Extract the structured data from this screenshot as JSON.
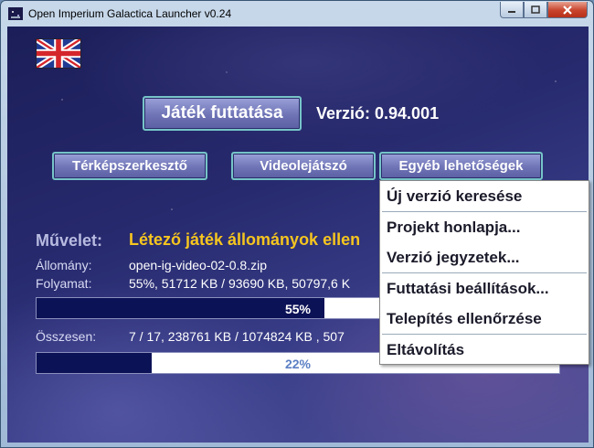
{
  "window": {
    "title": "Open Imperium Galactica Launcher v0.24"
  },
  "language": {
    "flag": "uk-flag-icon"
  },
  "main": {
    "run_label": "Játék futtatása",
    "version_text": "Verzió: 0.94.001",
    "map_editor_label": "Térképszerkesztő",
    "video_player_label": "Videolejátszó",
    "more_options_label": "Egyéb lehetőségek"
  },
  "status": {
    "operation_label": "Művelet:",
    "operation_value": "Létező játék állományok ellen",
    "file_label": "Állomány:",
    "file_value": "open-ig-video-02-0.8.zip",
    "progress_label": "Folyamat:",
    "progress_value": "55%, 51712 KB / 93690 KB, 50797,6 K",
    "progress_bar_text": "55%",
    "progress_fraction": 0.55,
    "total_label": "Összesen:",
    "total_value": "7 / 17, 238761 KB / 1074824 KB , 507",
    "total_bar_text": "22%",
    "total_fraction": 0.22
  },
  "menu": {
    "items": [
      "Új verzió keresése",
      "Projekt honlapja...",
      "Verzió jegyzetek...",
      "Futtatási beállítások...",
      "Telepítés ellenőrzése",
      "Eltávolítás"
    ]
  },
  "colors": {
    "operation": "#f6c51f",
    "progress_fill": "#0c1256",
    "progress_text_on_fill": "#ffffff",
    "total_text": "#5b7fc4"
  }
}
